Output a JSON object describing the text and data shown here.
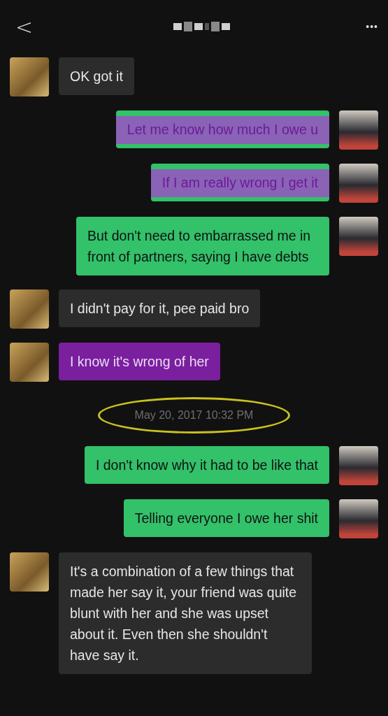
{
  "header": {
    "back": "<",
    "more": "•••"
  },
  "messages": [
    {
      "kind": "message",
      "outgoing": false,
      "highlighted": false,
      "text": "OK got it"
    },
    {
      "kind": "message",
      "outgoing": true,
      "highlighted": true,
      "text": "Let me know how much I owe u"
    },
    {
      "kind": "message",
      "outgoing": true,
      "highlighted": true,
      "text": "If I am really wrong I get it"
    },
    {
      "kind": "message",
      "outgoing": true,
      "highlighted": false,
      "text": "But don't need to embarrassed me in front of partners, saying I have debts"
    },
    {
      "kind": "message",
      "outgoing": false,
      "highlighted": false,
      "text": "I didn't pay for it, pee paid bro"
    },
    {
      "kind": "message",
      "outgoing": false,
      "highlighted": true,
      "text": "I know it's wrong of her"
    },
    {
      "kind": "timestamp",
      "circled": true,
      "text": "May 20, 2017 10:32 PM"
    },
    {
      "kind": "message",
      "outgoing": true,
      "highlighted": false,
      "text": "I don't know why it had to be like that"
    },
    {
      "kind": "message",
      "outgoing": true,
      "highlighted": false,
      "text": "Telling everyone I owe her shit"
    },
    {
      "kind": "message",
      "outgoing": false,
      "highlighted": false,
      "text": "It's a combination of a few things that made her say it, your friend was quite blunt with her and she was upset about it. Even then she shouldn't have say it."
    }
  ]
}
